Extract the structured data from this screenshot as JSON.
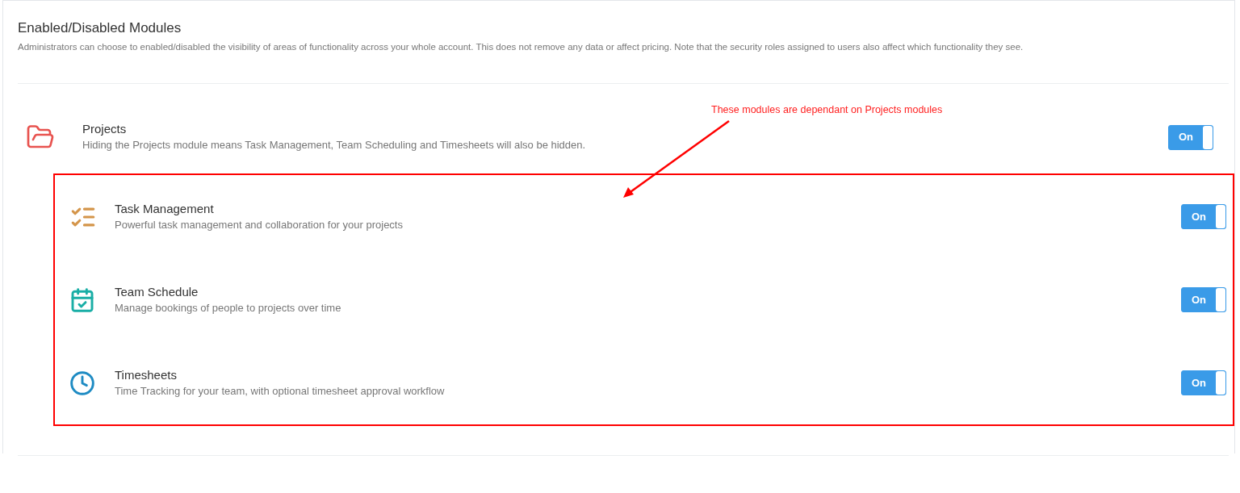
{
  "title": "Enabled/Disabled Modules",
  "description": "Administrators can choose to enabled/disabled the visibility of areas of functionality across your whole account. This does not remove any data or affect pricing. Note that the security roles assigned to users also affect which functionality they see.",
  "parent_module": {
    "name": "Projects",
    "description": "Hiding the Projects module means Task Management, Team Scheduling and Timesheets will also be hidden.",
    "on": true,
    "toggle_label": "On"
  },
  "annotation": {
    "text": "These modules are dependant on Projects modules"
  },
  "dependent_modules": [
    {
      "name": "Task Management",
      "description": "Powerful task management and collaboration for your projects",
      "on": true,
      "toggle_label": "On"
    },
    {
      "name": "Team Schedule",
      "description": "Manage bookings of people to projects over time",
      "on": true,
      "toggle_label": "On"
    },
    {
      "name": "Timesheets",
      "description": "Time Tracking for your team, with optional timesheet approval workflow",
      "on": true,
      "toggle_label": "On"
    }
  ]
}
